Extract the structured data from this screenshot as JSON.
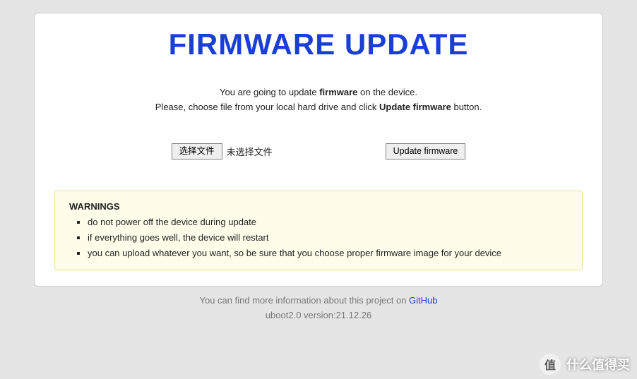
{
  "header": {
    "title": "FIRMWARE UPDATE"
  },
  "intro": {
    "prefix": "You are going to update ",
    "bold1": "firmware",
    "mid1": " on the device.",
    "line2_prefix": "Please, choose file from your local hard drive and click ",
    "bold2": "Update firmware",
    "line2_suffix": " button."
  },
  "actions": {
    "choose_file_label": "选择文件",
    "file_status": "未选择文件",
    "update_button_label": "Update firmware"
  },
  "warnings": {
    "title": "WARNINGS",
    "items": [
      "do not power off the device during update",
      "if everything goes well, the device will restart",
      "you can upload whatever you want, so be sure that you choose proper firmware image for your device"
    ]
  },
  "footer": {
    "info_prefix": "You can find more information about this project on ",
    "link_text": "GitHub",
    "version": "uboot2.0 version:21.12.26"
  },
  "watermark": {
    "icon_text": "值",
    "text": "什么值得买"
  }
}
